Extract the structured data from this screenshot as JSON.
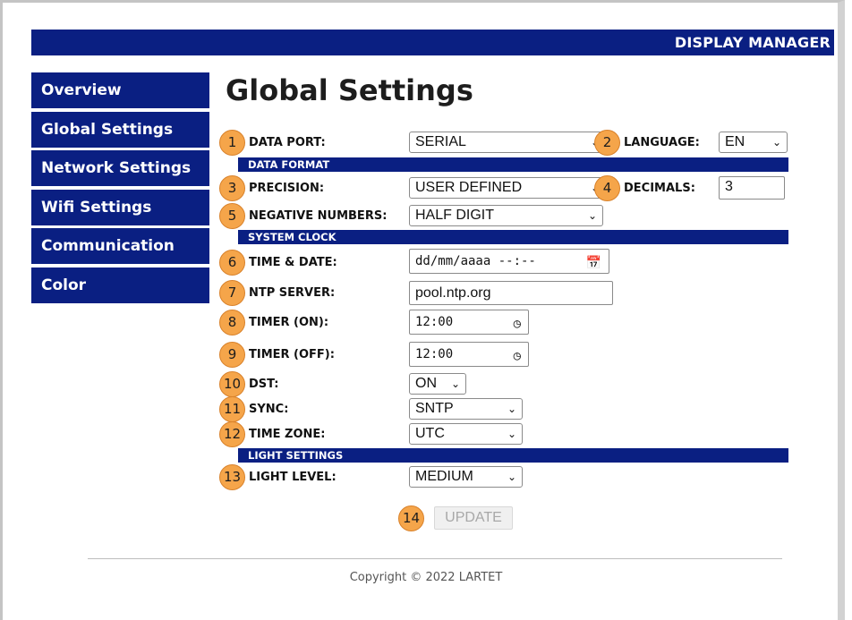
{
  "header": {
    "title": "DISPLAY MANAGER"
  },
  "sidebar": {
    "items": [
      {
        "label": "Overview"
      },
      {
        "label": "Global Settings"
      },
      {
        "label": "Network Settings"
      },
      {
        "label": "Wifi Settings"
      },
      {
        "label": "Communication"
      },
      {
        "label": "Color"
      }
    ]
  },
  "page": {
    "title": "Global Settings"
  },
  "sections": {
    "data_format": "DATA FORMAT",
    "system_clock": "SYSTEM CLOCK",
    "light_settings": "LIGHT SETTINGS"
  },
  "fields": {
    "data_port": {
      "badge": "1",
      "label": "DATA PORT:",
      "value": "SERIAL"
    },
    "language": {
      "badge": "2",
      "label": "LANGUAGE:",
      "value": "EN"
    },
    "precision": {
      "badge": "3",
      "label": "PRECISION:",
      "value": "USER DEFINED"
    },
    "decimals": {
      "badge": "4",
      "label": "DECIMALS:",
      "value": "3"
    },
    "negative_numbers": {
      "badge": "5",
      "label": "NEGATIVE NUMBERS:",
      "value": "HALF DIGIT"
    },
    "time_date": {
      "badge": "6",
      "label": "TIME & DATE:",
      "value": "dd/mm/aaaa --:--"
    },
    "ntp_server": {
      "badge": "7",
      "label": "NTP SERVER:",
      "value": "pool.ntp.org"
    },
    "timer_on": {
      "badge": "8",
      "label": "TIMER (ON):",
      "value": "12:00"
    },
    "timer_off": {
      "badge": "9",
      "label": "TIMER (OFF):",
      "value": "12:00"
    },
    "dst": {
      "badge": "10",
      "label": "DST:",
      "value": "ON"
    },
    "sync": {
      "badge": "11",
      "label": "SYNC:",
      "value": "SNTP"
    },
    "time_zone": {
      "badge": "12",
      "label": "TIME ZONE:",
      "value": "UTC"
    },
    "light_level": {
      "badge": "13",
      "label": "LIGHT LEVEL:",
      "value": "MEDIUM"
    }
  },
  "update": {
    "badge": "14",
    "label": "UPDATE"
  },
  "footer": {
    "copyright": "Copyright © 2022 LARTET"
  },
  "icons": {
    "chevron": "chevron-down-icon",
    "calendar": "calendar-icon",
    "clock": "clock-icon"
  },
  "colors": {
    "nav_bg": "#0a1f82",
    "badge": "#f5a54a",
    "text": "#111111"
  }
}
